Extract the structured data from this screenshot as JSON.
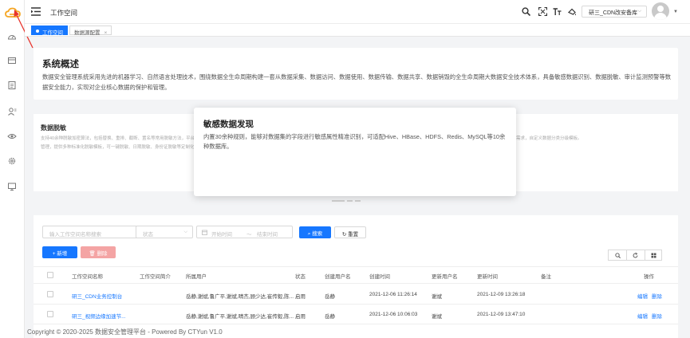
{
  "sidebar": {
    "logo": "cloud-logo-icon",
    "icons": [
      "dashboard-icon",
      "box-icon",
      "document-icon",
      "user-settings-icon",
      "eye-icon",
      "gear-icon",
      "monitor-icon"
    ]
  },
  "header": {
    "title": "工作空间",
    "icons": [
      "search-icon",
      "fullscreen-icon",
      "font-size-icon",
      "theme-icon"
    ],
    "user_select": "研三_CDN改安备库",
    "accent": "#1677ff"
  },
  "tabs": [
    {
      "label": "工作空间",
      "active": true
    },
    {
      "label": "数据源配置",
      "active": false
    }
  ],
  "overview": {
    "title": "系统概述",
    "description": "数据安全管理系统采用先进的机器学习、自然语言处理技术，围绕数据全生命周期构建一套从数据采集、数据访问、数据使用、数据传输、数据共享、数据销毁的全生命周期大数据安全技术体系，具备敏感数据识别、数据脱敏、审计监测预警等数据安全能力，实现对企业核心数据的保护和管理。"
  },
  "carousel": {
    "left_title": "数据脱敏",
    "left_desc": "支持40余种脱敏加密算法，包括替换、重排、截断、置名等常用脱敏方法，平台化管理，提供多种标准化脱敏模板，可一键脱敏、日期脱敏、身份证脱敏等定制化脱敏算法，同时支持动态、静态两种脱敏方式。",
    "right_desc": "需求，自定义数据分类分级模板。",
    "active_title": "敏感数据发现",
    "active_desc": "内置30余种规则，能够对数据集的字段进行敏感属性精准识别，可适配Hive、HBase、HDFS、Redis、MySQL等10余种数据库。"
  },
  "filters": {
    "search_placeholder": "输入工作空间名称搜索",
    "status_placeholder": "状态",
    "start_placeholder": "开始时间",
    "range_sep": "～",
    "end_placeholder": "结束时间",
    "search_btn": "搜索",
    "reset_btn": "重置"
  },
  "actions": {
    "add_btn": "新增",
    "delete_btn": "删除"
  },
  "table": {
    "columns": [
      "工作空间名称",
      "工作空间简介",
      "所属用户",
      "状态",
      "创建用户名",
      "创建时间",
      "更新用户名",
      "更新时间",
      "备注",
      "操作"
    ],
    "rows": [
      {
        "name": "研三_CDN业务控制台",
        "intro": "",
        "users": "岳静,谢斌,鲁广平,谢斌,晴杰,顾少达,崔传毅,陈...",
        "status": "启用",
        "creator": "岳静",
        "created": "2021-12-06 11:26:14",
        "updater": "谢斌",
        "updated": "2021-12-09 13:26:18",
        "remark": "",
        "ops": [
          "编辑",
          "删除"
        ]
      },
      {
        "name": "研三_视频边缘加速节...",
        "intro": "",
        "users": "岳静,谢斌,鲁广平,谢斌,晴杰,顾少达,崔传毅,陈...",
        "status": "启用",
        "creator": "岳静",
        "created": "2021-12-06 10:06:03",
        "updater": "谢斌",
        "updated": "2021-12-09 13:47:10",
        "remark": "",
        "ops": [
          "编辑",
          "删除"
        ]
      }
    ]
  },
  "footer": "Copyright © 2020-2025 数据安全管理平台 - Powered By CTYun V1.0"
}
